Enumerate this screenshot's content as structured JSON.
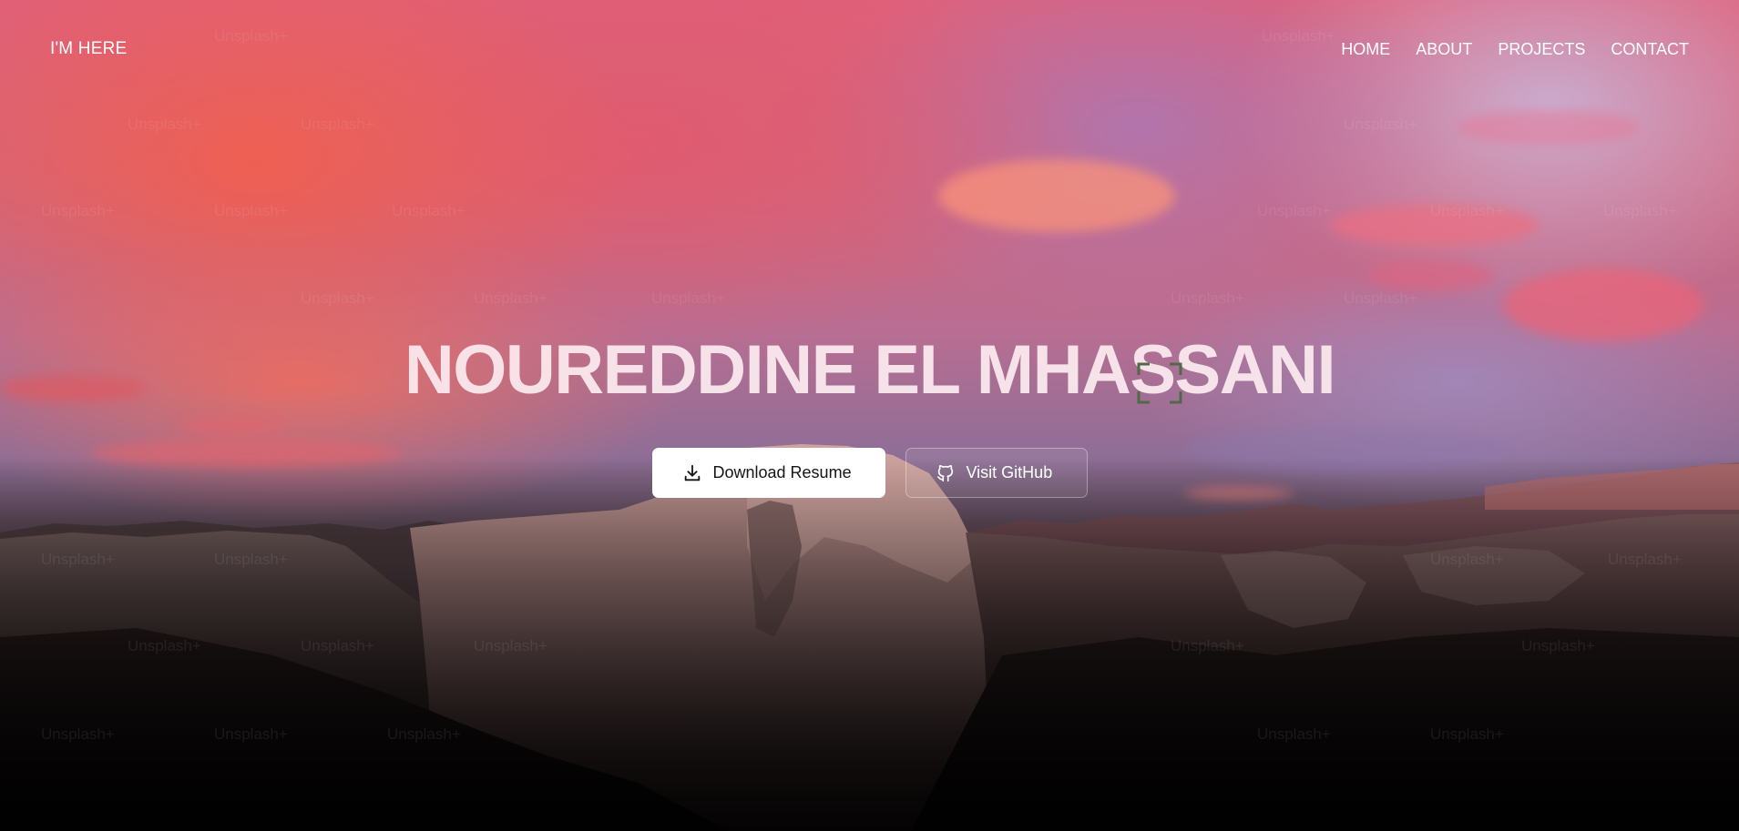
{
  "nav": {
    "brand": "I'M HERE",
    "links": [
      "HOME",
      "ABOUT",
      "PROJECTS",
      "CONTACT"
    ]
  },
  "hero": {
    "title": "NOUREDDINE EL MHASSANI",
    "buttons": {
      "download_label": "Download Resume",
      "github_label": "Visit GitHub"
    }
  },
  "background": {
    "watermark": "Unsplash+"
  },
  "colors": {
    "accent": "#ffffff",
    "sky_pink": "#e0607a",
    "sky_lavender": "#c8b4d7",
    "ground": "#0a0708"
  },
  "icons": {
    "download": "download-icon",
    "github": "github-icon"
  }
}
